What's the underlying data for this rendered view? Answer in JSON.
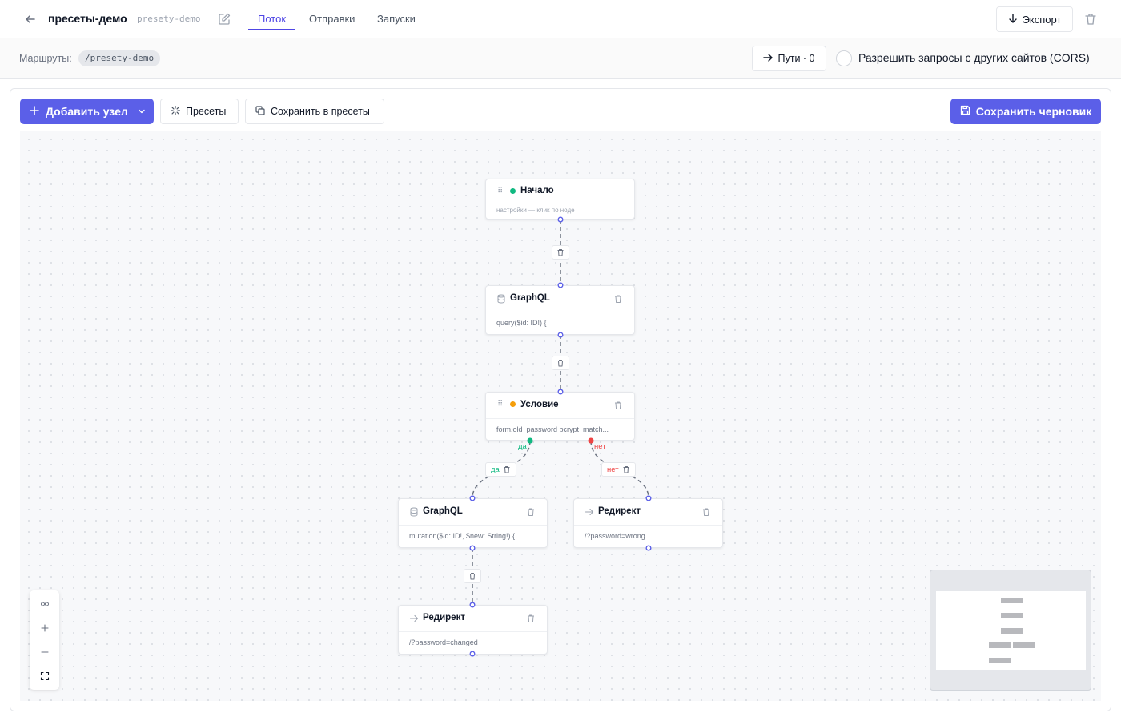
{
  "header": {
    "title": "пресеты-демо",
    "slug": "presety-demo",
    "tabs": [
      {
        "label": "Поток",
        "active": true
      },
      {
        "label": "Отправки",
        "active": false
      },
      {
        "label": "Запуски",
        "active": false
      }
    ],
    "export_label": "Экспорт"
  },
  "routes": {
    "label": "Маршруты:",
    "path": "/presety-demo",
    "paths_button": "Пути · 0",
    "cors_label": "Разрешить запросы с других сайтов (CORS)",
    "cors_enabled": false
  },
  "toolbar": {
    "add_node": "Добавить узел",
    "presets": "Пресеты",
    "save_to_presets": "Сохранить в пресеты",
    "save_draft": "Сохранить черновик"
  },
  "nodes": {
    "start": {
      "title": "Начало",
      "subtitle": "настройки — клик по ноде",
      "status_color": "#10b981"
    },
    "graphql1": {
      "title": "GraphQL",
      "body": "query($id: ID!) {"
    },
    "condition": {
      "title": "Условие",
      "body": "form.old_password bcrypt_match...",
      "status_color": "#f59e0b"
    },
    "graphql2": {
      "title": "GraphQL",
      "body": "mutation($id: ID!, $new: String!) {"
    },
    "redirect_wrong": {
      "title": "Редирект",
      "body": "/?password=wrong"
    },
    "redirect_changed": {
      "title": "Редирект",
      "body": "/?password=changed"
    }
  },
  "edges": {
    "yes_label": "да",
    "no_label": "нет"
  },
  "colors": {
    "accent": "#5b5fe8",
    "tab_active": "#4f46e5",
    "edge_yes": "#10b981",
    "edge_no": "#ef4444",
    "handle": "#5b5fe8"
  }
}
